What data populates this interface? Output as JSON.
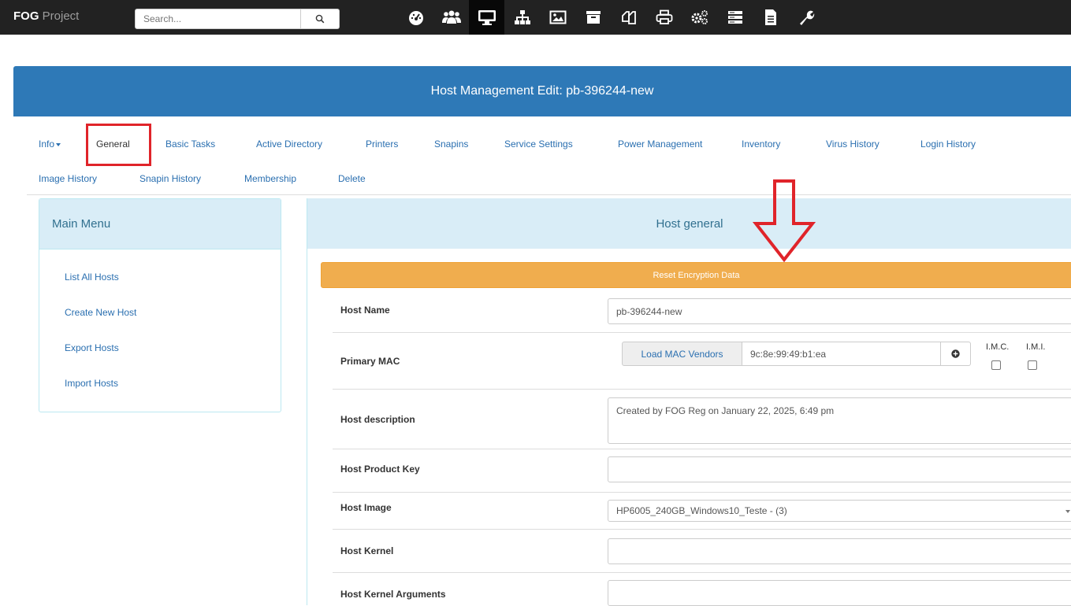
{
  "navbar": {
    "brand_bold": "FOG",
    "brand_rest": " Project",
    "search_placeholder": "Search...",
    "icons": [
      "dashboard-icon",
      "users-icon",
      "desktop-icon",
      "sitemap-icon",
      "image-icon",
      "archive-icon",
      "copy-icon",
      "print-icon",
      "cogs-icon",
      "server-icon",
      "file-icon",
      "wrench-icon"
    ],
    "active_icon": "desktop-icon"
  },
  "header": {
    "title": "Host Management Edit: pb-396244-new"
  },
  "tabs": {
    "row1": [
      "Info",
      "General",
      "Basic Tasks",
      "Active Directory",
      "Printers",
      "Snapins",
      "Service Settings",
      "Power Management",
      "Inventory",
      "Virus History",
      "Login History"
    ],
    "row2": [
      "Image History",
      "Snapin History",
      "Membership",
      "Delete"
    ],
    "highlighted": "General"
  },
  "menu": {
    "title": "Main Menu",
    "items": [
      "List All Hosts",
      "Create New Host",
      "Export Hosts",
      "Import Hosts"
    ]
  },
  "general": {
    "title": "Host general",
    "reset_button": "Reset Encryption Data",
    "host_name_label": "Host Name",
    "host_name_value": "pb-396244-new",
    "primary_mac_label": "Primary MAC",
    "load_mac_vendors": "Load MAC Vendors",
    "mac_value": "9c:8e:99:49:b1:ea",
    "imc_label": "I.M.C.",
    "imi_label": "I.M.I.",
    "description_label": "Host description",
    "description_value": "Created by FOG Reg on January 22, 2025, 6:49 pm",
    "product_key_label": "Host Product Key",
    "product_key_value": "",
    "image_label": "Host Image",
    "image_value": "HP6005_240GB_Windows10_Teste - (3)",
    "kernel_label": "Host Kernel",
    "kernel_value": "",
    "kernel_args_label": "Host Kernel Arguments",
    "kernel_args_value": ""
  },
  "colors": {
    "navbar": "#222222",
    "header": "#2e79b7",
    "panel_heading": "#d9edf7",
    "warning_button": "#f0ad4e",
    "annotation_red": "#e0242a",
    "link": "#2a6fb0"
  }
}
